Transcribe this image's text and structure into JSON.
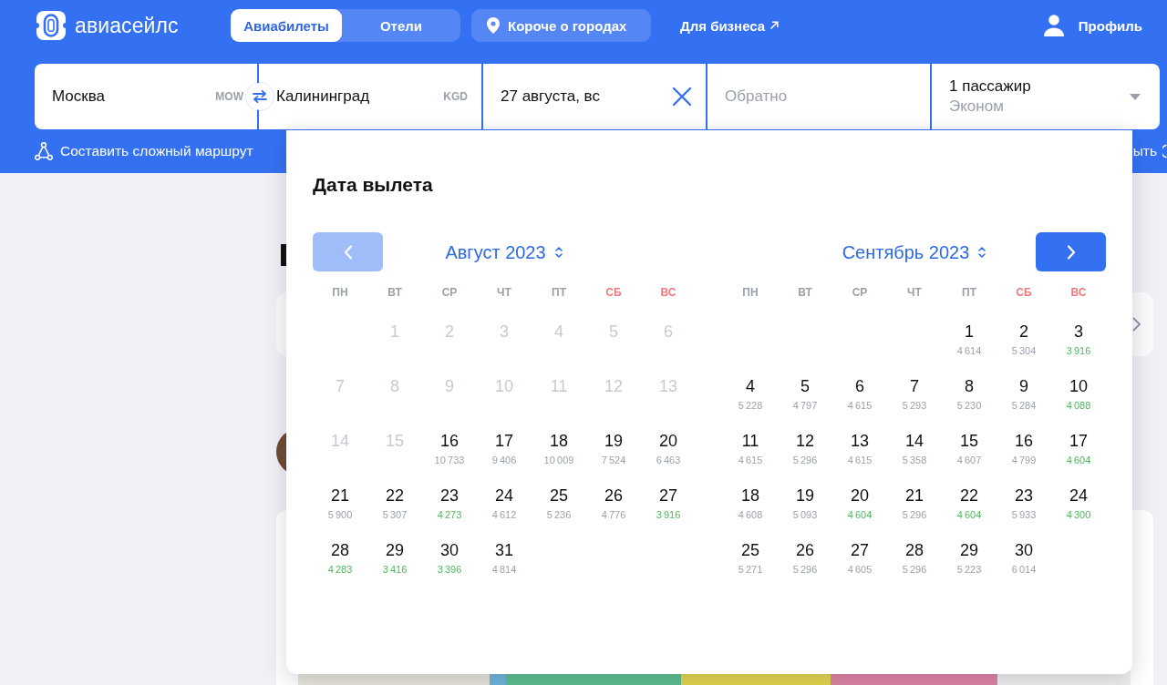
{
  "header": {
    "logo": "авиасейлс",
    "tabs": [
      {
        "label": "Авиабилеты",
        "selected": true
      },
      {
        "label": "Отели",
        "selected": false
      }
    ],
    "cities_link": "Короче о городах",
    "business_link": "Для бизнеса",
    "profile": "Профиль",
    "complex_route": "Составить сложный маршрут",
    "covered_link": "ыть"
  },
  "search": {
    "fields": [
      {
        "kind": "city",
        "value": "Москва",
        "code": "MOW"
      },
      {
        "kind": "city",
        "value": "Калининград",
        "code": "KGD"
      },
      {
        "kind": "date",
        "value": "27 августа, вс"
      },
      {
        "kind": "return",
        "placeholder": "Обратно"
      },
      {
        "kind": "passengers",
        "value": "1 пассажир",
        "subtitle": "Эконом"
      }
    ]
  },
  "calendar": {
    "title": "Дата вылета",
    "months": [
      {
        "title": "Август 2023",
        "nav": {
          "kind": "prev",
          "disabled": true
        },
        "weekdays": [
          {
            "label": "ПН",
            "weekend": false
          },
          {
            "label": "ВТ",
            "weekend": false
          },
          {
            "label": "СР",
            "weekend": false
          },
          {
            "label": "ЧТ",
            "weekend": false
          },
          {
            "label": "ПТ",
            "weekend": false
          },
          {
            "label": "СБ",
            "weekend": true
          },
          {
            "label": "ВС",
            "weekend": true
          }
        ],
        "weeks": [
          {
            "right_aligned": true,
            "days": [
              {
                "day": "1",
                "disabled": true
              },
              {
                "day": "2",
                "disabled": true
              },
              {
                "day": "3",
                "disabled": true
              },
              {
                "day": "4",
                "disabled": true
              },
              {
                "day": "5",
                "disabled": true
              },
              {
                "day": "6",
                "disabled": true
              }
            ]
          },
          {
            "right_aligned": false,
            "days": [
              {
                "day": "7",
                "disabled": true
              },
              {
                "day": "8",
                "disabled": true
              },
              {
                "day": "9",
                "disabled": true
              },
              {
                "day": "10",
                "disabled": true
              },
              {
                "day": "11",
                "disabled": true
              },
              {
                "day": "12",
                "disabled": true
              },
              {
                "day": "13",
                "disabled": true
              }
            ]
          },
          {
            "right_aligned": false,
            "days": [
              {
                "day": "14",
                "disabled": true
              },
              {
                "day": "15",
                "disabled": true
              },
              {
                "day": "16",
                "disabled": false,
                "price": "10 733",
                "cheap": false
              },
              {
                "day": "17",
                "disabled": false,
                "price": "9 406",
                "cheap": false
              },
              {
                "day": "18",
                "disabled": false,
                "price": "10 009",
                "cheap": false
              },
              {
                "day": "19",
                "disabled": false,
                "price": "7 524",
                "cheap": false
              },
              {
                "day": "20",
                "disabled": false,
                "price": "6 463",
                "cheap": false
              }
            ]
          },
          {
            "right_aligned": false,
            "days": [
              {
                "day": "21",
                "disabled": false,
                "price": "5 900",
                "cheap": false
              },
              {
                "day": "22",
                "disabled": false,
                "price": "5 307",
                "cheap": false
              },
              {
                "day": "23",
                "disabled": false,
                "price": "4 273",
                "cheap": true
              },
              {
                "day": "24",
                "disabled": false,
                "price": "4 612",
                "cheap": false
              },
              {
                "day": "25",
                "disabled": false,
                "price": "5 236",
                "cheap": false
              },
              {
                "day": "26",
                "disabled": false,
                "price": "4 776",
                "cheap": false
              },
              {
                "day": "27",
                "disabled": false,
                "price": "3 916",
                "cheap": true
              }
            ]
          },
          {
            "right_aligned": false,
            "days": [
              {
                "day": "28",
                "disabled": false,
                "price": "4 283",
                "cheap": true
              },
              {
                "day": "29",
                "disabled": false,
                "price": "3 416",
                "cheap": true
              },
              {
                "day": "30",
                "disabled": false,
                "price": "3 396",
                "cheap": true
              },
              {
                "day": "31",
                "disabled": false,
                "price": "4 814",
                "cheap": false
              }
            ]
          }
        ]
      },
      {
        "title": "Сентябрь 2023",
        "nav": {
          "kind": "next",
          "disabled": false
        },
        "weekdays": [
          {
            "label": "ПН",
            "weekend": false
          },
          {
            "label": "ВТ",
            "weekend": false
          },
          {
            "label": "СР",
            "weekend": false
          },
          {
            "label": "ЧТ",
            "weekend": false
          },
          {
            "label": "ПТ",
            "weekend": false
          },
          {
            "label": "СБ",
            "weekend": true
          },
          {
            "label": "ВС",
            "weekend": true
          }
        ],
        "weeks": [
          {
            "right_aligned": true,
            "days": [
              {
                "day": "1",
                "disabled": false,
                "price": "4 614",
                "cheap": false
              },
              {
                "day": "2",
                "disabled": false,
                "price": "5 304",
                "cheap": false
              },
              {
                "day": "3",
                "disabled": false,
                "price": "3 916",
                "cheap": true
              }
            ]
          },
          {
            "right_aligned": false,
            "days": [
              {
                "day": "4",
                "disabled": false,
                "price": "5 228",
                "cheap": false
              },
              {
                "day": "5",
                "disabled": false,
                "price": "4 797",
                "cheap": false
              },
              {
                "day": "6",
                "disabled": false,
                "price": "4 615",
                "cheap": false
              },
              {
                "day": "7",
                "disabled": false,
                "price": "5 293",
                "cheap": false
              },
              {
                "day": "8",
                "disabled": false,
                "price": "5 230",
                "cheap": false
              },
              {
                "day": "9",
                "disabled": false,
                "price": "5 284",
                "cheap": false
              },
              {
                "day": "10",
                "disabled": false,
                "price": "4 088",
                "cheap": true
              }
            ]
          },
          {
            "right_aligned": false,
            "days": [
              {
                "day": "11",
                "disabled": false,
                "price": "4 615",
                "cheap": false
              },
              {
                "day": "12",
                "disabled": false,
                "price": "5 296",
                "cheap": false
              },
              {
                "day": "13",
                "disabled": false,
                "price": "4 615",
                "cheap": false
              },
              {
                "day": "14",
                "disabled": false,
                "price": "5 358",
                "cheap": false
              },
              {
                "day": "15",
                "disabled": false,
                "price": "4 607",
                "cheap": false
              },
              {
                "day": "16",
                "disabled": false,
                "price": "4 799",
                "cheap": false
              },
              {
                "day": "17",
                "disabled": false,
                "price": "4 604",
                "cheap": true
              }
            ]
          },
          {
            "right_aligned": false,
            "days": [
              {
                "day": "18",
                "disabled": false,
                "price": "4 608",
                "cheap": false
              },
              {
                "day": "19",
                "disabled": false,
                "price": "5 093",
                "cheap": false
              },
              {
                "day": "20",
                "disabled": false,
                "price": "4 604",
                "cheap": true
              },
              {
                "day": "21",
                "disabled": false,
                "price": "5 296",
                "cheap": false
              },
              {
                "day": "22",
                "disabled": false,
                "price": "4 604",
                "cheap": true
              },
              {
                "day": "23",
                "disabled": false,
                "price": "5 933",
                "cheap": false
              },
              {
                "day": "24",
                "disabled": false,
                "price": "4 300",
                "cheap": true
              }
            ]
          },
          {
            "right_aligned": false,
            "days": [
              {
                "day": "25",
                "disabled": false,
                "price": "5 271",
                "cheap": false
              },
              {
                "day": "26",
                "disabled": false,
                "price": "5 296",
                "cheap": false
              },
              {
                "day": "27",
                "disabled": false,
                "price": "4 605",
                "cheap": false
              },
              {
                "day": "28",
                "disabled": false,
                "price": "5 296",
                "cheap": false
              },
              {
                "day": "29",
                "disabled": false,
                "price": "5 223",
                "cheap": false
              },
              {
                "day": "30",
                "disabled": false,
                "price": "6 014",
                "cheap": false
              }
            ]
          }
        ]
      }
    ]
  }
}
